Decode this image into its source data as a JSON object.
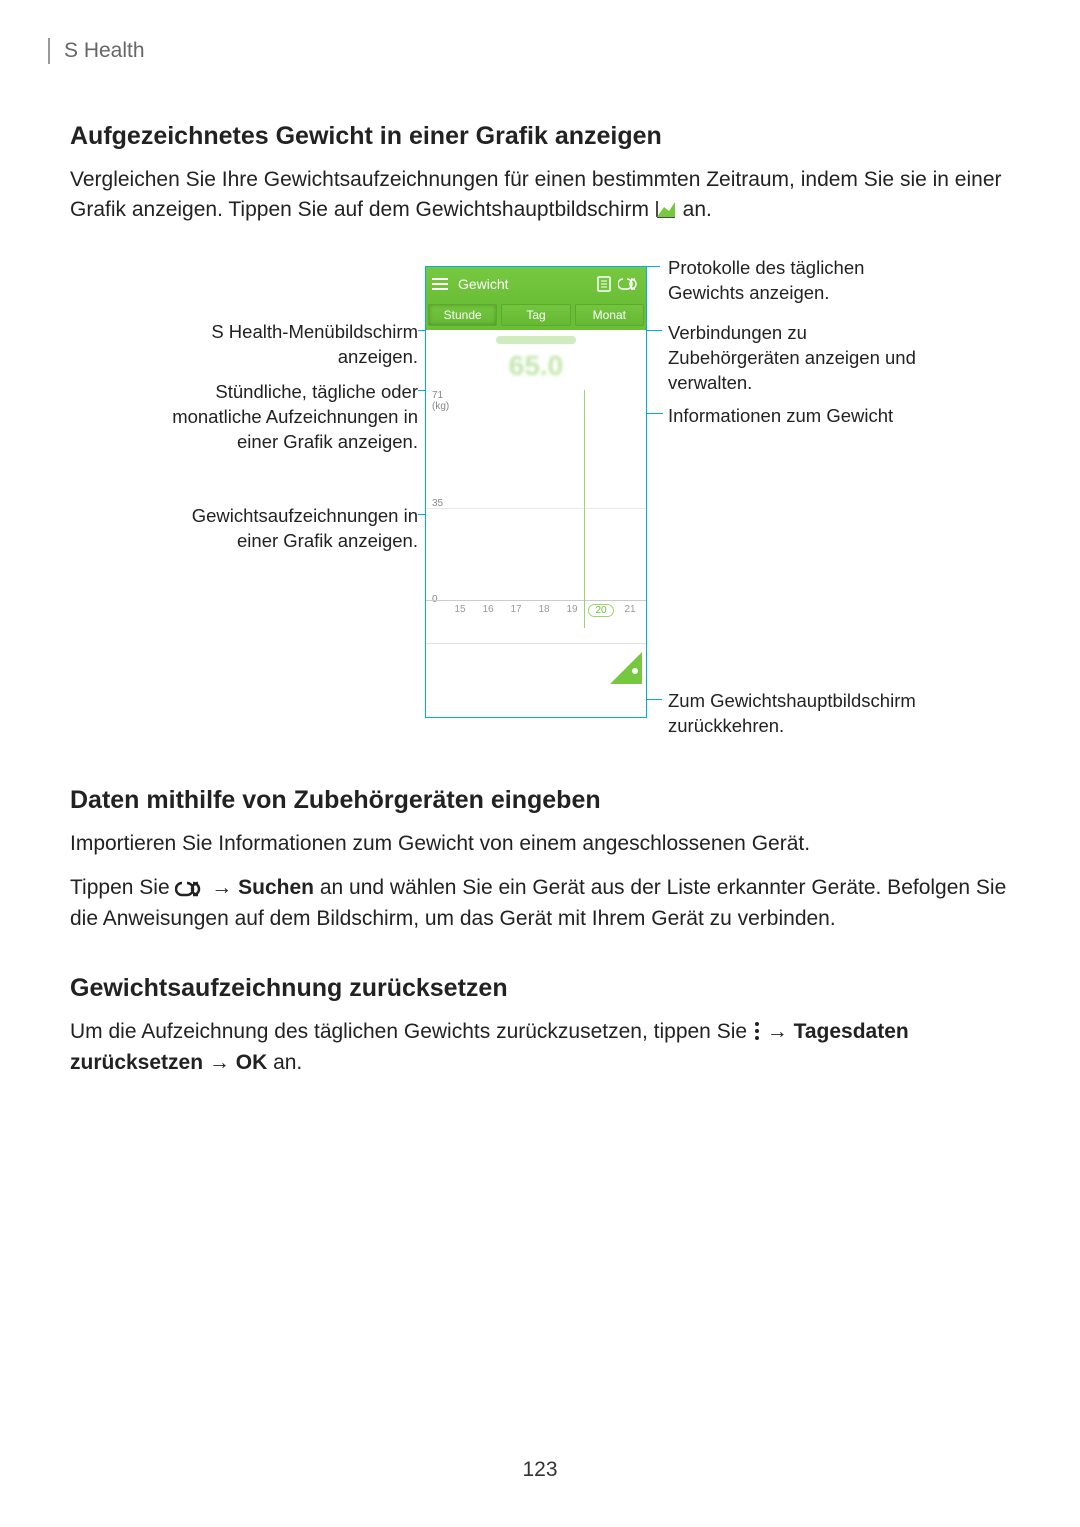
{
  "header": {
    "app_name": "S Health"
  },
  "section1": {
    "heading": "Aufgezeichnetes Gewicht in einer Grafik anzeigen",
    "para_a": "Vergleichen Sie Ihre Gewichtsaufzeichnungen für einen bestimmten Zeitraum, indem Sie sie in einer Grafik anzeigen. Tippen Sie auf dem Gewichtshauptbildschirm ",
    "para_b": " an."
  },
  "phone": {
    "title": "Gewicht",
    "tabs": {
      "hour": "Stunde",
      "day": "Tag",
      "month": "Monat"
    },
    "big_value": "65.0",
    "y_top": "71",
    "y_unit": "(kg)",
    "y_mid": "35",
    "y_bot": "0",
    "xticks": [
      "15",
      "16",
      "17",
      "18",
      "19",
      "20",
      "21"
    ],
    "today_idx": 5
  },
  "callouts": {
    "left1": "S Health-Menübildschirm anzeigen.",
    "left2": "Stündliche, tägliche oder monatliche Aufzeichnungen in einer Grafik anzeigen.",
    "left3": "Gewichtsaufzeichnungen in einer Grafik anzeigen.",
    "right1": "Protokolle des täglichen Gewichts anzeigen.",
    "right2": "Verbindungen zu Zubehörgeräten anzeigen und verwalten.",
    "right3": "Informationen zum Gewicht",
    "right4": "Zum Gewichtshauptbildschirm zurückkehren."
  },
  "section2": {
    "heading": "Daten mithilfe von Zubehörgeräten eingeben",
    "p1": "Importieren Sie Informationen zum Gewicht von einem angeschlossenen Gerät.",
    "p2a": "Tippen Sie ",
    "p2arrow": " → ",
    "p2bold": "Suchen",
    "p2b": " an und wählen Sie ein Gerät aus der Liste erkannter Geräte. Befolgen Sie die Anweisungen auf dem Bildschirm, um das Gerät mit Ihrem Gerät zu verbinden."
  },
  "section3": {
    "heading": "Gewichtsaufzeichnung zurücksetzen",
    "p_a": "Um die Aufzeichnung des täglichen Gewichts zurückzusetzen, tippen Sie ",
    "p_arrow1": " → ",
    "p_bold": "Tagesdaten zurücksetzen",
    "p_arrow2": " → ",
    "p_ok": "OK",
    "p_b": " an."
  },
  "page_number": "123",
  "chart_data": {
    "type": "line",
    "title": "Gewicht",
    "xlabel": "",
    "ylabel": "(kg)",
    "ylim": [
      0,
      71
    ],
    "x": [
      15,
      16,
      17,
      18,
      19,
      20,
      21
    ],
    "values": [
      null,
      null,
      null,
      null,
      null,
      null,
      null
    ]
  }
}
